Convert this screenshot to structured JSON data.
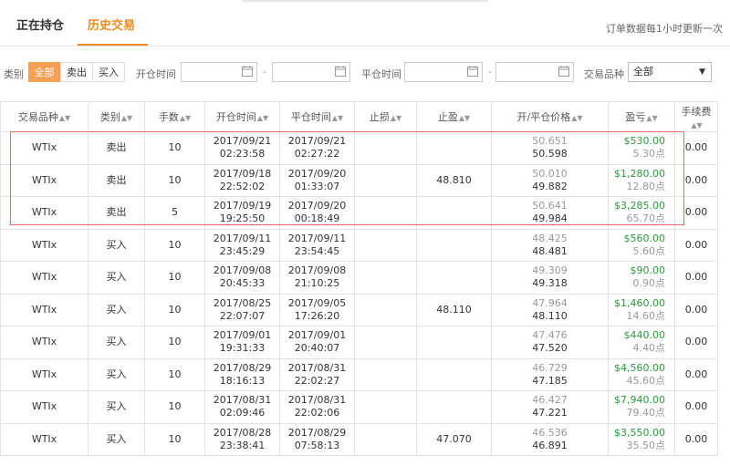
{
  "tabs": {
    "open_positions": "正在持仓",
    "history": "历史交易",
    "notice": "订单数据每1小时更新一次"
  },
  "filters": {
    "type_label": "类别",
    "type_options": [
      "全部",
      "卖出",
      "买入"
    ],
    "open_time_label": "开仓时间",
    "close_time_label": "平仓时间",
    "dash": "-",
    "product_label": "交易品种",
    "product_value": "全部"
  },
  "table": {
    "headers": [
      "交易品种",
      "类别",
      "手数",
      "开仓时间",
      "平仓时间",
      "止损",
      "止盈",
      "开/平仓价格",
      "盈亏",
      "手续费"
    ],
    "rows": [
      {
        "product": "WTIx",
        "type": "卖出",
        "side": "sell",
        "lots": "10",
        "open_date": "2017/09/21",
        "open_time": "02:23:58",
        "close_date": "2017/09/21",
        "close_time": "02:27:22",
        "sl": "",
        "tp": "",
        "open_price": "50.651",
        "close_price": "50.598",
        "pnl": "$530.00",
        "points": "5.30点",
        "fee": "0.00"
      },
      {
        "product": "WTIx",
        "type": "卖出",
        "side": "sell",
        "lots": "10",
        "open_date": "2017/09/18",
        "open_time": "22:52:02",
        "close_date": "2017/09/20",
        "close_time": "01:33:07",
        "sl": "",
        "tp": "48.810",
        "open_price": "50.010",
        "close_price": "49.882",
        "pnl": "$1,280.00",
        "points": "12.80点",
        "fee": "0.00"
      },
      {
        "product": "WTIx",
        "type": "卖出",
        "side": "sell",
        "lots": "5",
        "open_date": "2017/09/19",
        "open_time": "19:25:50",
        "close_date": "2017/09/20",
        "close_time": "00:18:49",
        "sl": "",
        "tp": "",
        "open_price": "50.641",
        "close_price": "49.984",
        "pnl": "$3,285.00",
        "points": "65.70点",
        "fee": "0.00"
      },
      {
        "product": "WTIx",
        "type": "买入",
        "side": "buy",
        "lots": "10",
        "open_date": "2017/09/11",
        "open_time": "23:45:29",
        "close_date": "2017/09/11",
        "close_time": "23:54:45",
        "sl": "",
        "tp": "",
        "open_price": "48.425",
        "close_price": "48.481",
        "pnl": "$560.00",
        "points": "5.60点",
        "fee": "0.00"
      },
      {
        "product": "WTIx",
        "type": "买入",
        "side": "buy",
        "lots": "10",
        "open_date": "2017/09/08",
        "open_time": "20:45:33",
        "close_date": "2017/09/08",
        "close_time": "21:10:25",
        "sl": "",
        "tp": "",
        "open_price": "49.309",
        "close_price": "49.318",
        "pnl": "$90.00",
        "points": "0.90点",
        "fee": "0.00"
      },
      {
        "product": "WTIx",
        "type": "买入",
        "side": "buy",
        "lots": "10",
        "open_date": "2017/08/25",
        "open_time": "22:07:07",
        "close_date": "2017/09/05",
        "close_time": "17:26:20",
        "sl": "",
        "tp": "48.110",
        "open_price": "47.964",
        "close_price": "48.110",
        "pnl": "$1,460.00",
        "points": "14.60点",
        "fee": "0.00"
      },
      {
        "product": "WTIx",
        "type": "买入",
        "side": "buy",
        "lots": "10",
        "open_date": "2017/09/01",
        "open_time": "19:31:33",
        "close_date": "2017/09/01",
        "close_time": "20:40:07",
        "sl": "",
        "tp": "",
        "open_price": "47.476",
        "close_price": "47.520",
        "pnl": "$440.00",
        "points": "4.40点",
        "fee": "0.00"
      },
      {
        "product": "WTIx",
        "type": "买入",
        "side": "buy",
        "lots": "10",
        "open_date": "2017/08/29",
        "open_time": "18:16:13",
        "close_date": "2017/08/31",
        "close_time": "22:02:27",
        "sl": "",
        "tp": "",
        "open_price": "46.729",
        "close_price": "47.185",
        "pnl": "$4,560.00",
        "points": "45.60点",
        "fee": "0.00"
      },
      {
        "product": "WTIx",
        "type": "买入",
        "side": "buy",
        "lots": "10",
        "open_date": "2017/08/31",
        "open_time": "02:09:46",
        "close_date": "2017/08/31",
        "close_time": "22:02:06",
        "sl": "",
        "tp": "",
        "open_price": "46.427",
        "close_price": "47.221",
        "pnl": "$7,940.00",
        "points": "79.40点",
        "fee": "0.00"
      },
      {
        "product": "WTIx",
        "type": "买入",
        "side": "buy",
        "lots": "10",
        "open_date": "2017/08/28",
        "open_time": "23:38:41",
        "close_date": "2017/08/29",
        "close_time": "07:58:13",
        "sl": "",
        "tp": "47.070",
        "open_price": "46.536",
        "close_price": "46.891",
        "pnl": "$3,550.00",
        "points": "35.50点",
        "fee": "0.00"
      }
    ]
  },
  "colors": {
    "accent": "#f08a1e",
    "sell": "#e53935",
    "buy": "#2e9e5b",
    "profit": "#2a9a3a",
    "highlight": "#e86a6a"
  }
}
